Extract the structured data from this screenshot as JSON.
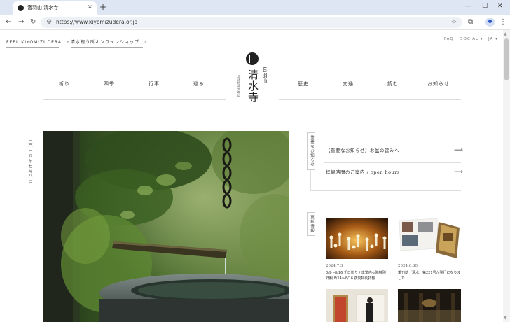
{
  "browser": {
    "tab_title": "音羽山 清水寺",
    "close_glyph": "×",
    "newtab_glyph": "+",
    "url": "https://www.kiyomizudera.or.jp",
    "window_min": "—",
    "window_max": "☐",
    "window_close": "✕",
    "back_glyph": "←",
    "forward_glyph": "→",
    "reload_glyph": "↻",
    "site_info_glyph": "⚙",
    "star_glyph": "☆",
    "extensions_glyph": "⧉",
    "menu_glyph": "⋮"
  },
  "header": {
    "links": [
      {
        "label": "FEEL KIYOMIZUDERA"
      },
      {
        "label": "清水椀う所オンラインショップ"
      }
    ],
    "util": [
      "FAQ",
      "SOCIAL ▾",
      "JA ▾"
    ],
    "logo_mountain": "音羽山",
    "logo_temple": "清水寺",
    "logo_sub": "北法相宗大本山"
  },
  "nav": {
    "items": [
      "祈り",
      "四季",
      "行事",
      "巡る",
      "歴史",
      "交通",
      "読む",
      "お知らせ"
    ]
  },
  "hero": {
    "date_vertical": "二〇二四年七月八日"
  },
  "notices": {
    "tag": "重要なお知らせ",
    "items": [
      {
        "text": "【重要なお知らせ】お盆の営みへ",
        "arrow": "⟶"
      },
      {
        "text": "拝観時間のご案内 / open hours",
        "arrow": "⟶"
      }
    ]
  },
  "updates": {
    "tag": "更新情報",
    "items": [
      {
        "date": "2024.7.3",
        "caption_1": "8/9〜8/16 千日詣り / 本堂内々陣特別",
        "caption_2": "拝観 8/14〜8/16 夜間特別拝観"
      },
      {
        "date": "2024.6.30",
        "caption_1": "季刊誌『清水』第221号が発行になりま",
        "caption_2": "した"
      }
    ]
  }
}
